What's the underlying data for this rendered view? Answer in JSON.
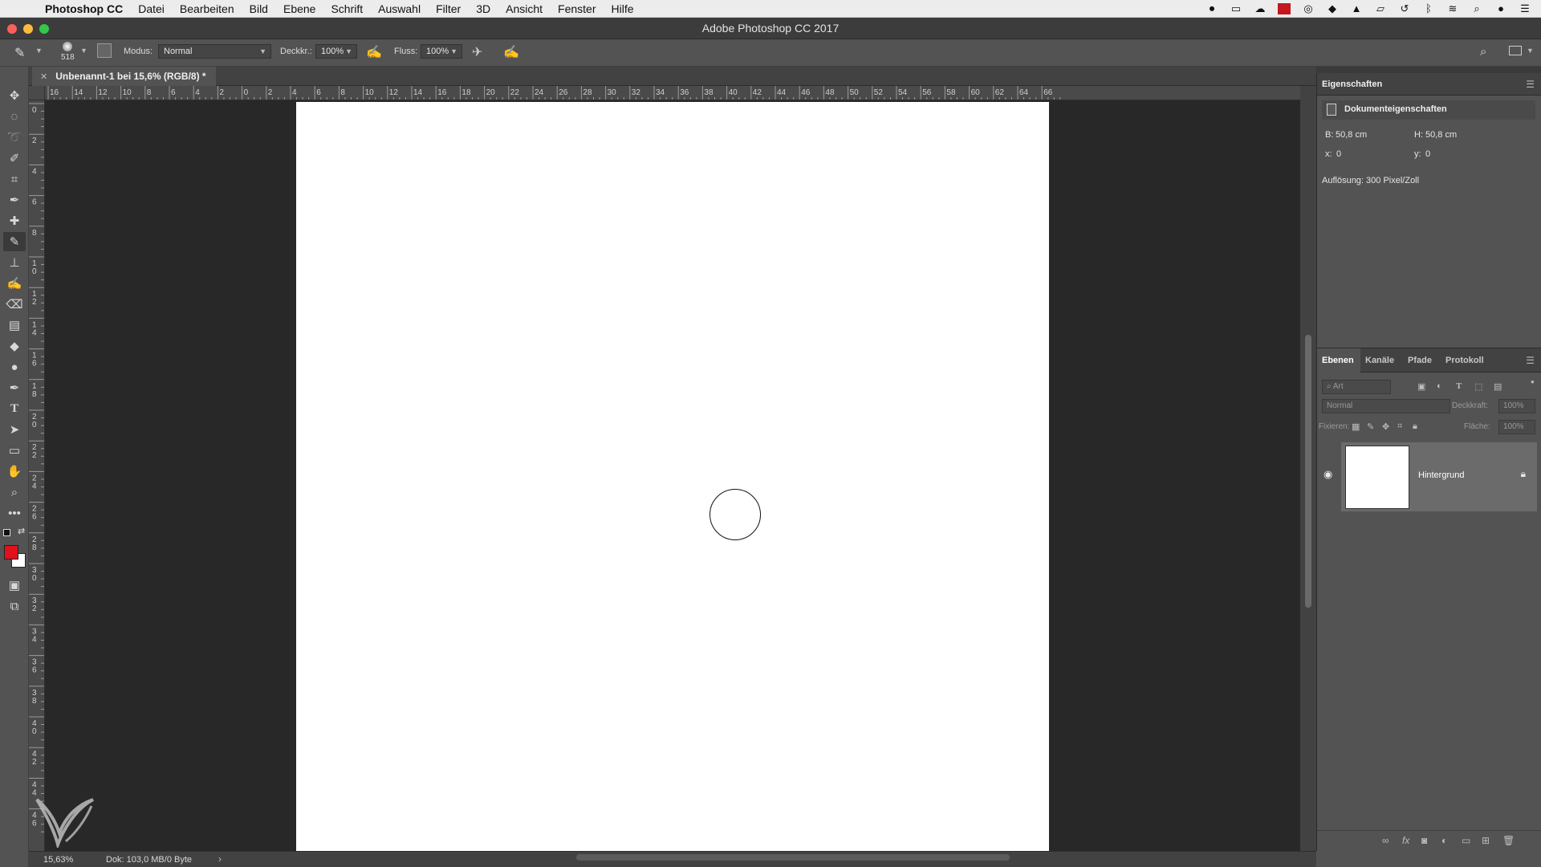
{
  "menubar": {
    "app_name": "Photoshop CC",
    "items": [
      "Datei",
      "Bearbeiten",
      "Bild",
      "Ebene",
      "Schrift",
      "Auswahl",
      "Filter",
      "3D",
      "Ansicht",
      "Fenster",
      "Hilfe"
    ]
  },
  "window": {
    "title": "Adobe Photoshop CC 2017"
  },
  "options": {
    "brush_size": "518",
    "mode_label": "Modus:",
    "mode_value": "Normal",
    "opacity_label": "Deckkr.:",
    "opacity_value": "100%",
    "flow_label": "Fluss:",
    "flow_value": "100%"
  },
  "document": {
    "tab_title": "Unbenannt-1 bei 15,6% (RGB/8) *",
    "zoom": "15,63%",
    "doc_info": "Dok: 103,0 MB/0 Byte"
  },
  "rulers": {
    "horizontal": [
      "16",
      "14",
      "12",
      "10",
      "8",
      "6",
      "4",
      "2",
      "0",
      "2",
      "4",
      "6",
      "8",
      "10",
      "12",
      "14",
      "16",
      "18",
      "20",
      "22",
      "24",
      "26",
      "28",
      "30",
      "32",
      "34",
      "36",
      "38",
      "40",
      "42",
      "44",
      "46",
      "48",
      "50",
      "52",
      "54",
      "56",
      "58",
      "60",
      "62",
      "64",
      "66"
    ],
    "vertical": [
      "0",
      "2",
      "4",
      "6",
      "8",
      "10",
      "12",
      "14",
      "16",
      "18",
      "20",
      "22",
      "24",
      "26",
      "28",
      "30",
      "32",
      "34",
      "36",
      "38",
      "40",
      "42",
      "44",
      "46"
    ]
  },
  "properties": {
    "title": "Eigenschaften",
    "section": "Dokumenteigenschaften",
    "width_label": "B:",
    "width_value": "50,8 cm",
    "height_label": "H:",
    "height_value": "50,8 cm",
    "x_label": "x:",
    "x_value": "0",
    "y_label": "y:",
    "y_value": "0",
    "resolution": "Auflösung: 300 Pixel/Zoll"
  },
  "layers": {
    "tabs": [
      "Ebenen",
      "Kanäle",
      "Pfade",
      "Protokoll"
    ],
    "filter_placeholder": "Art",
    "blend_mode": "Normal",
    "opacity_label": "Deckkraft:",
    "opacity_value": "100%",
    "lock_label": "Fixieren:",
    "fill_label": "Fläche:",
    "fill_value": "100%",
    "layer_name": "Hintergrund"
  },
  "colors": {
    "foreground": "#e0101c",
    "background": "#ffffff",
    "canvas_bg": "#282828"
  }
}
